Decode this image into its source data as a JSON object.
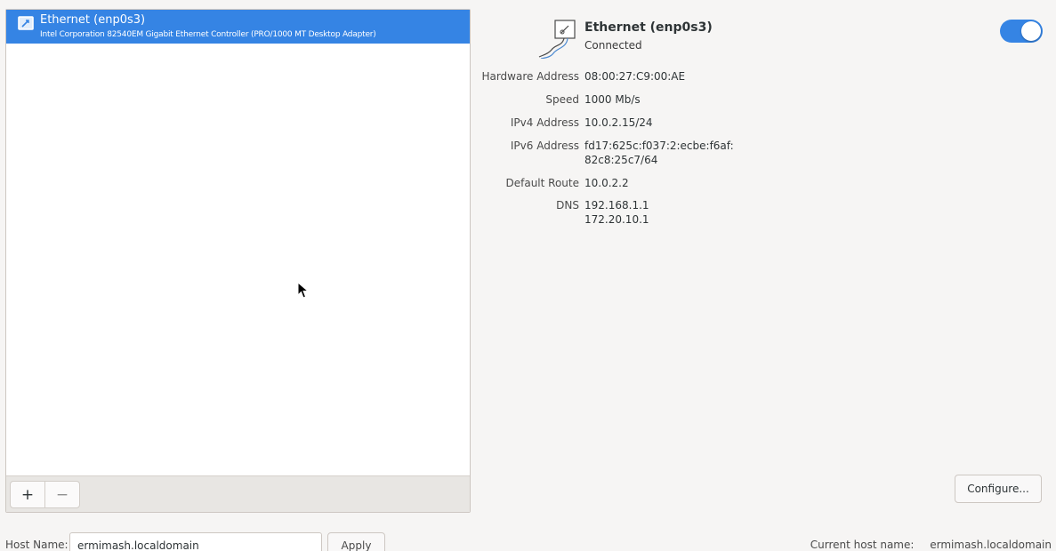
{
  "connections": [
    {
      "title": "Ethernet (enp0s3)",
      "subtitle": "Intel Corporation 82540EM Gigabit Ethernet Controller (PRO/1000 MT Desktop Adapter)",
      "icon": "network-wired-icon",
      "selected": true
    }
  ],
  "list_toolbar": {
    "add_label": "+",
    "remove_label": "−"
  },
  "detail": {
    "title": "Ethernet (enp0s3)",
    "status": "Connected",
    "enabled": true,
    "properties": {
      "hw_label": "Hardware Address",
      "hw_value": "08:00:27:C9:00:AE",
      "speed_label": "Speed",
      "speed_value": "1000 Mb/s",
      "ipv4_label": "IPv4 Address",
      "ipv4_value": "10.0.2.15/24",
      "ipv6_label": "IPv6 Address",
      "ipv6_value_1": "fd17:625c:f037:2:ecbe:f6af:",
      "ipv6_value_2": "82c8:25c7/64",
      "route_label": "Default Route",
      "route_value": "10.0.2.2",
      "dns_label": "DNS",
      "dns_value_1": "192.168.1.1",
      "dns_value_2": "172.20.10.1"
    },
    "configure_label": "Configure..."
  },
  "host": {
    "label": "Host Name:",
    "value": "ermimash.localdomain",
    "apply_label": "Apply",
    "current_label": "Current host name:",
    "current_value": "ermimash.localdomain"
  },
  "colors": {
    "accent": "#3584e4",
    "background": "#f6f5f4"
  }
}
